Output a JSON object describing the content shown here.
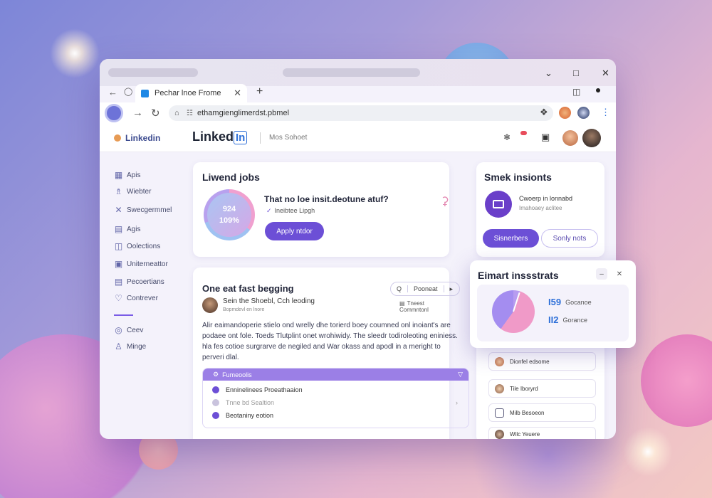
{
  "browser": {
    "tab_title": "Pechar lnoe Frome",
    "url": "ethamgienglimerdst.pbmel"
  },
  "header": {
    "logo_small": "Linkedin",
    "logo_big_text": "Linked",
    "logo_big_badge": "In",
    "search_text": "Mos Sohoet",
    "notification_dot_color": "#e84c5b"
  },
  "sidebar": {
    "items": [
      {
        "label": "Apis",
        "icon": "grid-icon"
      },
      {
        "label": "Wiebter",
        "icon": "person-icon"
      },
      {
        "label": "Swecgermmel",
        "icon": "tools-icon"
      },
      {
        "label": "Agis",
        "icon": "book-icon"
      },
      {
        "label": "Oolections",
        "icon": "collection-icon"
      },
      {
        "label": "Uniterneattor",
        "icon": "calendar-icon"
      },
      {
        "label": "Pecoertians",
        "icon": "document-icon"
      },
      {
        "label": "Contrever",
        "icon": "pin-icon"
      },
      {
        "label": "Ceev",
        "icon": "globe-icon"
      },
      {
        "label": "Minge",
        "icon": "user-icon"
      }
    ]
  },
  "jobs_card": {
    "title": "Liwend jobs",
    "ring_value_top": "924",
    "ring_value_bottom": "109%",
    "question": "That no loe insit.deotune atuf?",
    "sub": "Ineibtee Lipgh",
    "button": "Apply ntdor"
  },
  "smek_card": {
    "title": "Smek insionts",
    "line1": "Cwoerp in lonnabd",
    "line2": "Imahoaey aclitee",
    "btn_primary": "Sisnerbers",
    "btn_secondary": "Sonly nots"
  },
  "feed_card": {
    "title": "One eat fast begging",
    "tool_left": "Q",
    "tool_mid": "Pooneat",
    "tool_right": "▸",
    "author_name": "Sein the Shoebl, Cch leoding",
    "author_sub": "Bopmdevl en lnore",
    "author_meta": "Tneest Commntonl",
    "body": "Alir eaimandoperie stielo ond wrelly dhe torierd boey coumned onl inoiant's are podaee ont fole. Toeds Tlutplint onet wrohiwidy. The sleedr todiroleoting eniniess. hla fes cotioe surgrarve de negiled and War okass and apodl in a meright to perveri dlal.",
    "panel_header": "Fumeoolis",
    "panel_rows": [
      {
        "label": "Enninelinees Proeathaaion",
        "muted": false
      },
      {
        "label": "Tnne bd Sealtion",
        "muted": true
      },
      {
        "label": "Beotaniny eotion",
        "muted": false
      }
    ]
  },
  "popup": {
    "title": "Eimart inssstrats",
    "legend": [
      {
        "value": "59",
        "label": "Gocanoe",
        "prefix": "I"
      },
      {
        "value": "I2",
        "label": "Gorance",
        "prefix": "I"
      }
    ]
  },
  "people_list": [
    {
      "name": "Dionfel edsome"
    },
    {
      "name": "Tile Iboryrd"
    },
    {
      "name": "Milb Besoeon"
    },
    {
      "name": "Wilc Yeuere"
    }
  ]
}
